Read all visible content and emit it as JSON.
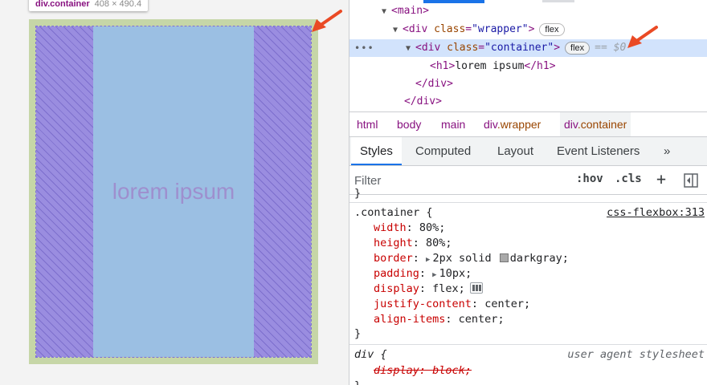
{
  "tooltip": {
    "selector": "div.container",
    "dimensions": "408 × 490.4"
  },
  "page": {
    "heading": "lorem ipsum"
  },
  "dom": {
    "main_tag": "<main>",
    "wrapper_open": "<div",
    "wrapper_attr": "class",
    "wrapper_val": "\"wrapper\"",
    "wrapper_close": ">",
    "container_open": "<div",
    "container_attr": "class",
    "container_val": "\"container\"",
    "container_close": ">",
    "h1_open": "<h1>",
    "h1_text": "lorem ipsum",
    "h1_close": "</h1>",
    "div_close": "</div>",
    "div_close2": "</div>",
    "flex_badge": "flex",
    "selected_marker": "== $0",
    "dots": "•••"
  },
  "breadcrumb": {
    "items": [
      "html",
      "body",
      "main"
    ],
    "wrapper_tag": "div",
    "wrapper_cls": ".wrapper",
    "container_tag": "div",
    "container_cls": ".container"
  },
  "tabs": {
    "styles": "Styles",
    "computed": "Computed",
    "layout": "Layout",
    "event_listeners": "Event Listeners",
    "more": "»"
  },
  "filter": {
    "placeholder": "Filter",
    "hov": ":hov",
    "cls": ".cls",
    "plus": "+"
  },
  "rules": {
    "open_brace_top": "}",
    "container_selector": ".container {",
    "container_source": "css-flexbox:313",
    "width_name": "width",
    "width_val": "80%;",
    "height_name": "height",
    "height_val": "80%;",
    "border_name": "border",
    "border_val_a": "2px solid",
    "border_val_b": "darkgray;",
    "padding_name": "padding",
    "padding_val": "10px;",
    "display_name": "display",
    "display_val": "flex;",
    "justify_name": "justify-content",
    "justify_val": "center;",
    "align_name": "align-items",
    "align_val": "center;",
    "container_close": "}",
    "div_selector": "div {",
    "div_source": "user agent stylesheet",
    "ua_display_name": "display",
    "ua_display_val": "block;",
    "div_close": "}"
  },
  "colors": {
    "accent": "#1a73e8",
    "arrow": "#ea4a25",
    "tag": "#881280",
    "prop": "#c80000"
  }
}
